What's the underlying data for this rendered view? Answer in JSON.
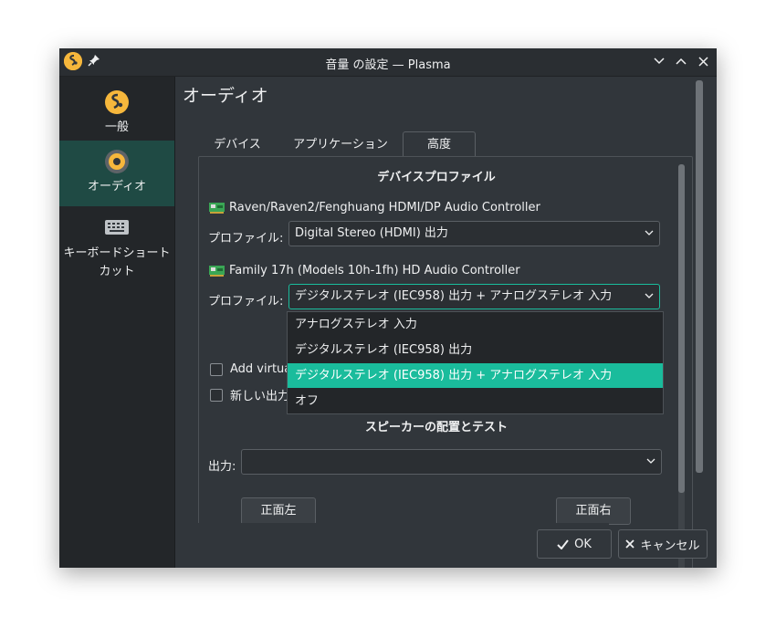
{
  "window": {
    "title": "音量 の設定 — Plasma",
    "minimize_icon": "chevron-down-icon",
    "maximize_icon": "chevron-up-icon",
    "close_icon": "close-icon"
  },
  "sidebar": {
    "items": [
      {
        "label": "一般",
        "icon": "general-settings-icon"
      },
      {
        "label": "オーディオ",
        "icon": "audio-icon"
      },
      {
        "label": "キーボードショートカット",
        "label_line1": "キーボードショート",
        "label_line2": "カット",
        "icon": "keyboard-icon"
      }
    ],
    "active_index": 1
  },
  "page": {
    "title": "オーディオ"
  },
  "tabs": [
    {
      "label": "デバイス"
    },
    {
      "label": "アプリケーション"
    },
    {
      "label": "高度"
    }
  ],
  "device_profiles": {
    "section_title": "デバイスプロファイル",
    "devices": [
      {
        "name": "Raven/Raven2/Fenghuang HDMI/DP Audio Controller",
        "profile_label": "プロファイル:",
        "profile_value": "Digital Stereo (HDMI) 出力"
      },
      {
        "name": "Family 17h (Models 10h-1fh) HD Audio Controller",
        "profile_label": "プロファイル:",
        "profile_value": "デジタルステレオ (IEC958) 出力 + アナログステレオ 入力"
      }
    ]
  },
  "dropdown": {
    "options": [
      "アナログステレオ 入力",
      "デジタルステレオ (IEC958) 出力",
      "デジタルステレオ (IEC958) 出力 + アナログステレオ 入力",
      "オフ"
    ],
    "selected_index": 2
  },
  "options": {
    "add_virtual_partial": "Add virtua",
    "new_output_partial": "新しい出力"
  },
  "speaker": {
    "section_title": "スピーカーの配置とテスト",
    "output_label": "出力:",
    "output_value": "",
    "front_left": "正面左",
    "front_right": "正面右"
  },
  "footer": {
    "ok_label": "OK",
    "cancel_label": "キャンセル"
  },
  "colors": {
    "accent": "#1abc9c",
    "window_bg": "#31363b",
    "sidebar_bg": "#232629",
    "active_item_bg": "#1f4a44"
  }
}
